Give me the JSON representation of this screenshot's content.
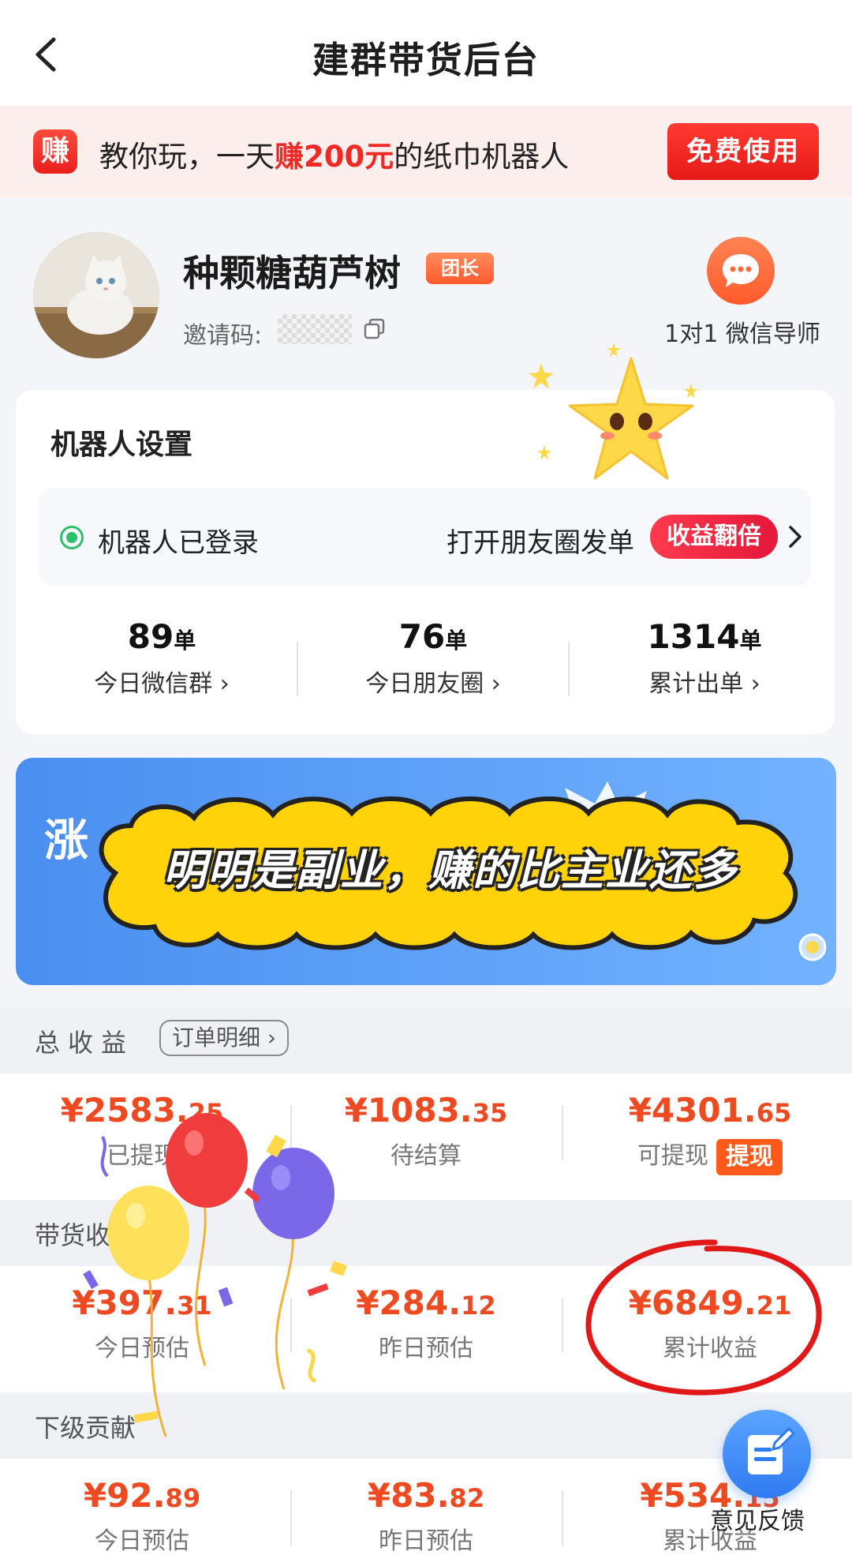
{
  "header": {
    "title": "建群带货后台",
    "back_icon": "back-arrow-icon"
  },
  "promo": {
    "badge": "赚",
    "text_before": "教你玩，一天",
    "text_highlight": "赚200元",
    "text_after": "的纸巾机器人",
    "button": "免费使用",
    "accent": "#ee2a24"
  },
  "profile": {
    "username": "种颗糖葫芦树",
    "role_tag": "团长",
    "invite_label": "邀请码:",
    "mentor_label": "1对1 微信导师"
  },
  "robot": {
    "title": "机器人设置",
    "status": "机器人已登录",
    "moments_link": "打开朋友圈发单",
    "double_badge": "收益翻倍",
    "stats": [
      {
        "value": "89",
        "unit": "单",
        "label": "今日微信群"
      },
      {
        "value": "76",
        "unit": "单",
        "label": "今日朋友圈"
      },
      {
        "value": "1314",
        "unit": "单",
        "label": "累计出单"
      }
    ]
  },
  "banner": {
    "left_text": "涨",
    "slogan": "明明是副业，赚的比主业还多"
  },
  "total": {
    "title": "总收益",
    "detail_button": "订单明细",
    "cells": [
      {
        "yuan": "¥2583.",
        "cents": "25",
        "label": "已提现"
      },
      {
        "yuan": "¥1083.",
        "cents": "35",
        "label": "待结算"
      },
      {
        "yuan": "¥4301.",
        "cents": "65",
        "label": "可提现",
        "action": "提现"
      }
    ]
  },
  "sales": {
    "title": "带货收益",
    "cells": [
      {
        "yuan": "¥397.",
        "cents": "31",
        "label": "今日预估"
      },
      {
        "yuan": "¥284.",
        "cents": "12",
        "label": "昨日预估"
      },
      {
        "yuan": "¥6849.",
        "cents": "21",
        "label": "累计收益"
      }
    ]
  },
  "sub": {
    "title": "下级贡献",
    "cells": [
      {
        "yuan": "¥92.",
        "cents": "89",
        "label": "今日预估"
      },
      {
        "yuan": "¥83.",
        "cents": "82",
        "label": "昨日预估"
      },
      {
        "yuan": "¥534.",
        "cents": "15",
        "label": "累计收益"
      }
    ]
  },
  "feedback": {
    "label": "意见反馈"
  },
  "colors": {
    "money": "#ee4a22",
    "brand_red": "#e51a18",
    "status_green": "#2fbf6c",
    "banner_blue": "#4a8ff0"
  }
}
